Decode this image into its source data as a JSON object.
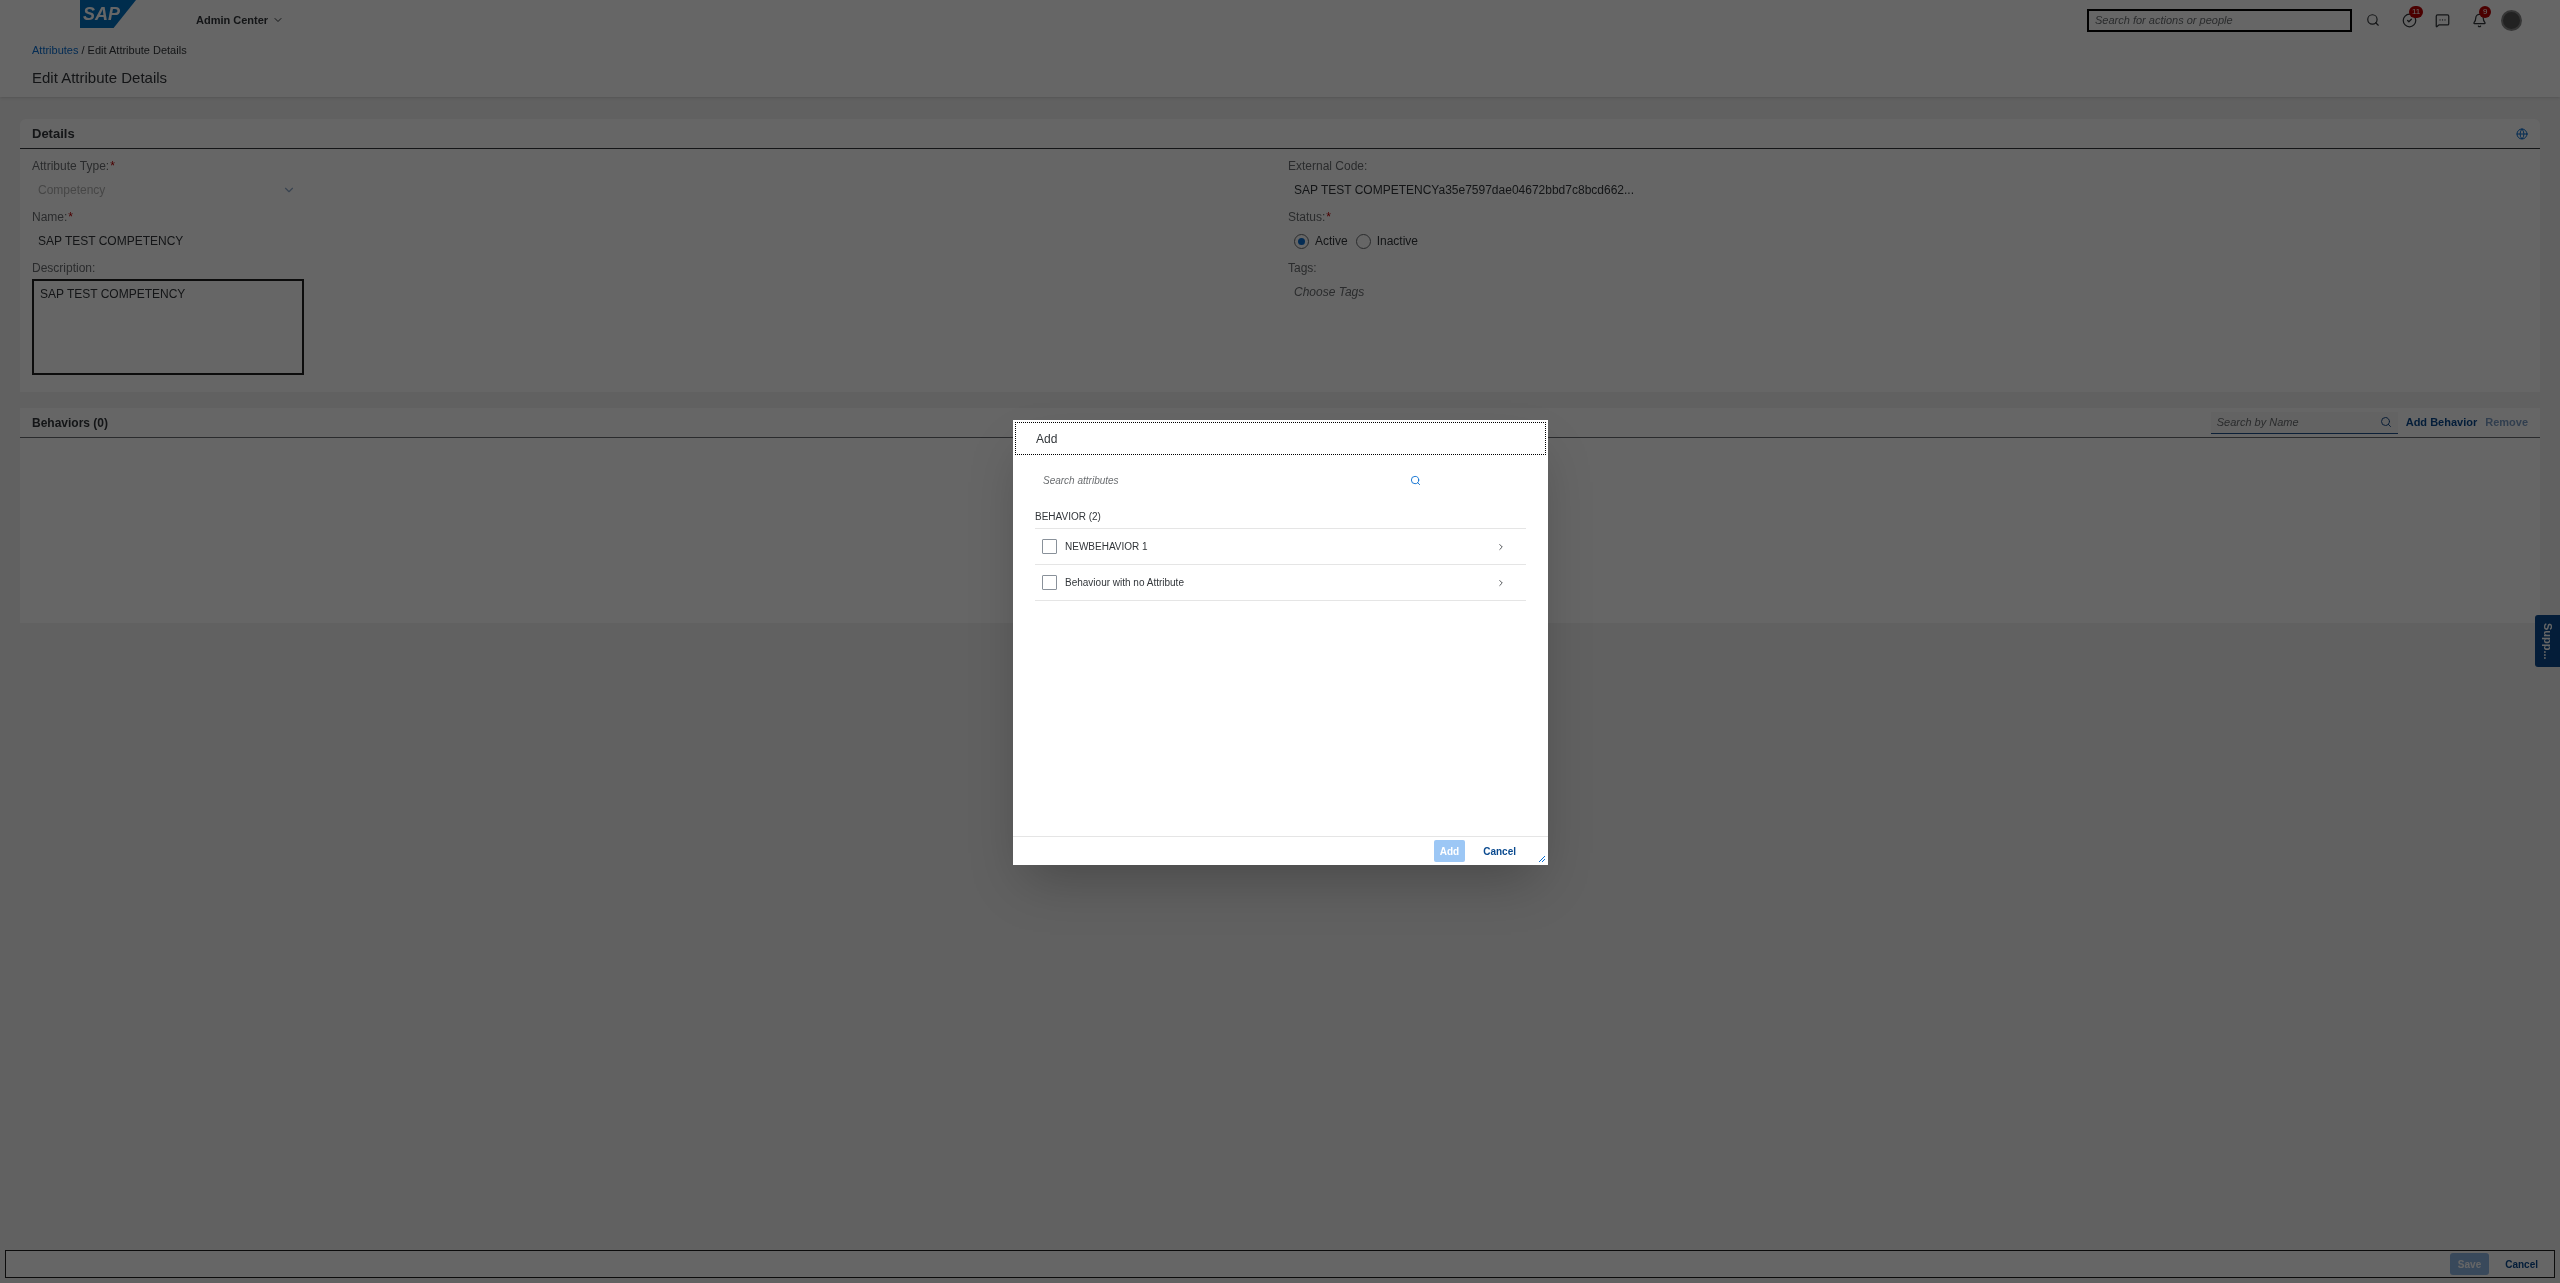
{
  "header": {
    "logo": "SAP",
    "app_menu": "Admin Center",
    "search": {
      "placeholder": "Search for actions or people"
    },
    "todo_badge": "11",
    "notification_badge": "9"
  },
  "breadcrumb": [
    {
      "label": "Attributes",
      "kind": "link"
    },
    {
      "label": "/ Edit Attribute Details",
      "kind": "current"
    }
  ],
  "page_title": "Edit Attribute Details",
  "details": {
    "title": "Details",
    "left_fields": [
      {
        "label": "Attribute Type:",
        "required_mark": "*",
        "kind": "select",
        "value": "Competency",
        "disabled": true
      },
      {
        "label": "Name:",
        "required_mark": "*",
        "kind": "text",
        "value": "SAP TEST COMPETENCY"
      },
      {
        "label": "Description:",
        "kind": "textarea",
        "value": "SAP TEST COMPETENCY"
      }
    ],
    "right_fields": [
      {
        "label": "External Code:",
        "kind": "text",
        "value": "SAP TEST COMPETENCYa35e7597dae04672bbd7c8bcd662..."
      },
      {
        "label": "Status:",
        "required_mark": "*",
        "kind": "radio",
        "options": [
          {
            "label": "Active",
            "selected": true
          },
          {
            "label": "Inactive",
            "selected": false
          }
        ]
      },
      {
        "label": "Tags:",
        "kind": "tags",
        "placeholder": "Choose Tags"
      }
    ]
  },
  "behaviors": {
    "title": "Behaviors (0)",
    "search": {
      "placeholder": "Search by Name"
    },
    "actions": [
      {
        "label": "Add Behavior",
        "disabled": false
      },
      {
        "label": "Remove",
        "disabled": true
      }
    ]
  },
  "side_tab": "Supp...",
  "footer": {
    "buttons": [
      {
        "label": "Save",
        "kind": "primary",
        "disabled": true
      },
      {
        "label": "Cancel",
        "kind": "plain",
        "disabled": false
      }
    ]
  },
  "dialog": {
    "title": "Add",
    "search": {
      "placeholder": "Search attributes"
    },
    "group": "BEHAVIOR (2)",
    "items": [
      {
        "label": "NEWBEHAVIOR 1",
        "checked": false
      },
      {
        "label": "Behaviour with no Attribute",
        "checked": false
      }
    ],
    "buttons": [
      {
        "label": "Add",
        "kind": "primary",
        "disabled": true
      },
      {
        "label": "Cancel",
        "kind": "plain",
        "disabled": false
      }
    ]
  }
}
